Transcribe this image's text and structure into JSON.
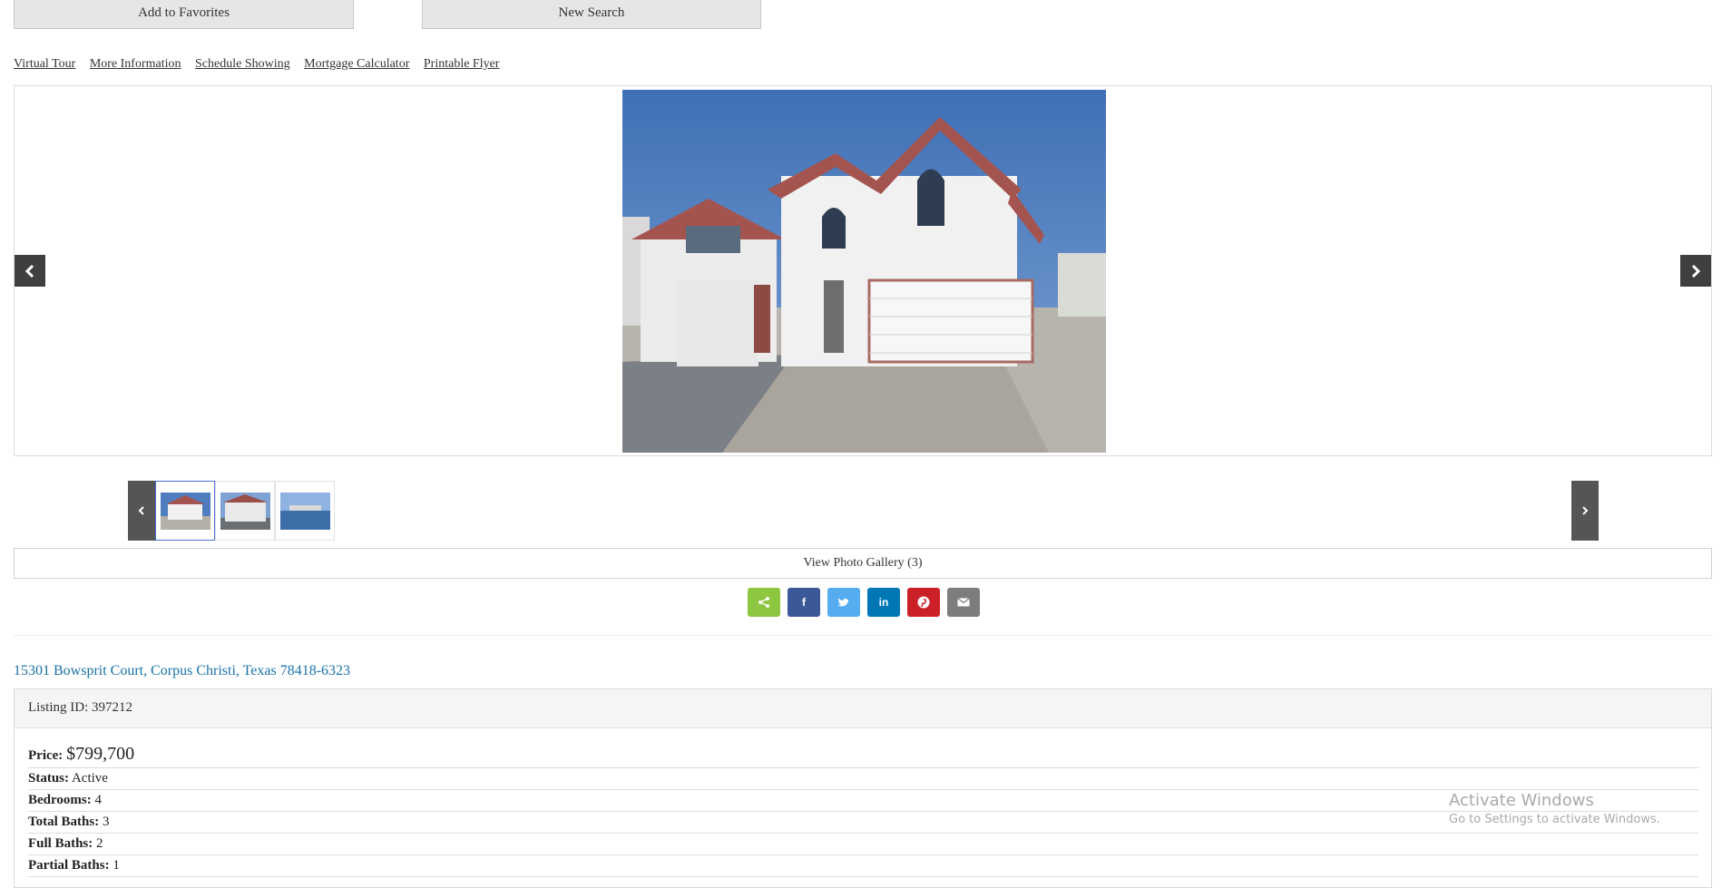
{
  "buttons": {
    "add_favorites": "Add to Favorites",
    "new_search": "New Search"
  },
  "links": [
    "Virtual Tour",
    "More Information",
    "Schedule Showing",
    "Mortgage Calculator",
    "Printable Flyer"
  ],
  "gallery_button": "View Photo Gallery (3)",
  "share": {
    "colors": {
      "share": "#8dc63f",
      "facebook": "#3b5998",
      "twitter": "#55acee",
      "linkedin": "#0077b5",
      "pinterest": "#cb2027",
      "email": "#7d7d7d"
    },
    "labels": {
      "facebook": "f",
      "linkedin": "in"
    }
  },
  "address": "15301 Bowsprit Court, Corpus Christi, Texas 78418-6323",
  "listing": {
    "id_text": "Listing ID: 397212",
    "price_label": "Price:",
    "price_value": "$799,700",
    "status_label": "Status:",
    "status_value": "Active",
    "bedrooms_label": "Bedrooms:",
    "bedrooms_value": "4",
    "total_baths_label": "Total Baths:",
    "total_baths_value": "3",
    "full_baths_label": "Full Baths:",
    "full_baths_value": "2",
    "partial_baths_label": "Partial Baths:",
    "partial_baths_value": "1"
  },
  "watermark": {
    "line1": "Activate Windows",
    "line2": "Go to Settings to activate Windows."
  }
}
